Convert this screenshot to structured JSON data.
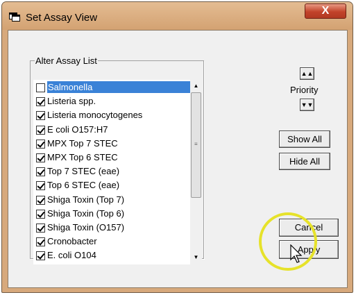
{
  "window": {
    "title": "Set Assay View",
    "close_label": "X"
  },
  "assay_group": {
    "legend": "Alter Assay List",
    "items": [
      {
        "label": "Salmonella",
        "checked": false,
        "selected": true
      },
      {
        "label": "Listeria spp.",
        "checked": true,
        "selected": false
      },
      {
        "label": "Listeria monocytogenes",
        "checked": true,
        "selected": false
      },
      {
        "label": "E coli O157:H7",
        "checked": true,
        "selected": false
      },
      {
        "label": "MPX Top 7 STEC",
        "checked": true,
        "selected": false
      },
      {
        "label": "MPX Top 6 STEC",
        "checked": true,
        "selected": false
      },
      {
        "label": "Top 7 STEC (eae)",
        "checked": true,
        "selected": false
      },
      {
        "label": "Top 6 STEC (eae)",
        "checked": true,
        "selected": false
      },
      {
        "label": "Shiga Toxin (Top 7)",
        "checked": true,
        "selected": false
      },
      {
        "label": "Shiga Toxin (Top 6)",
        "checked": true,
        "selected": false
      },
      {
        "label": "Shiga Toxin (O157)",
        "checked": true,
        "selected": false
      },
      {
        "label": "Cronobacter",
        "checked": true,
        "selected": false
      },
      {
        "label": "E. coli O104",
        "checked": true,
        "selected": false
      }
    ]
  },
  "priority": {
    "label": "Priority",
    "up_icon": "double-chevron-up-icon",
    "down_icon": "double-chevron-down-icon"
  },
  "buttons": {
    "show_all": "Show All",
    "hide_all": "Hide All",
    "cancel": "Cancel",
    "apply": "Apply"
  },
  "colors": {
    "title_bar": "#d7a97c",
    "selection": "#3a82d7",
    "highlight_ring": "#e6e22a",
    "close": "#c2432a"
  }
}
